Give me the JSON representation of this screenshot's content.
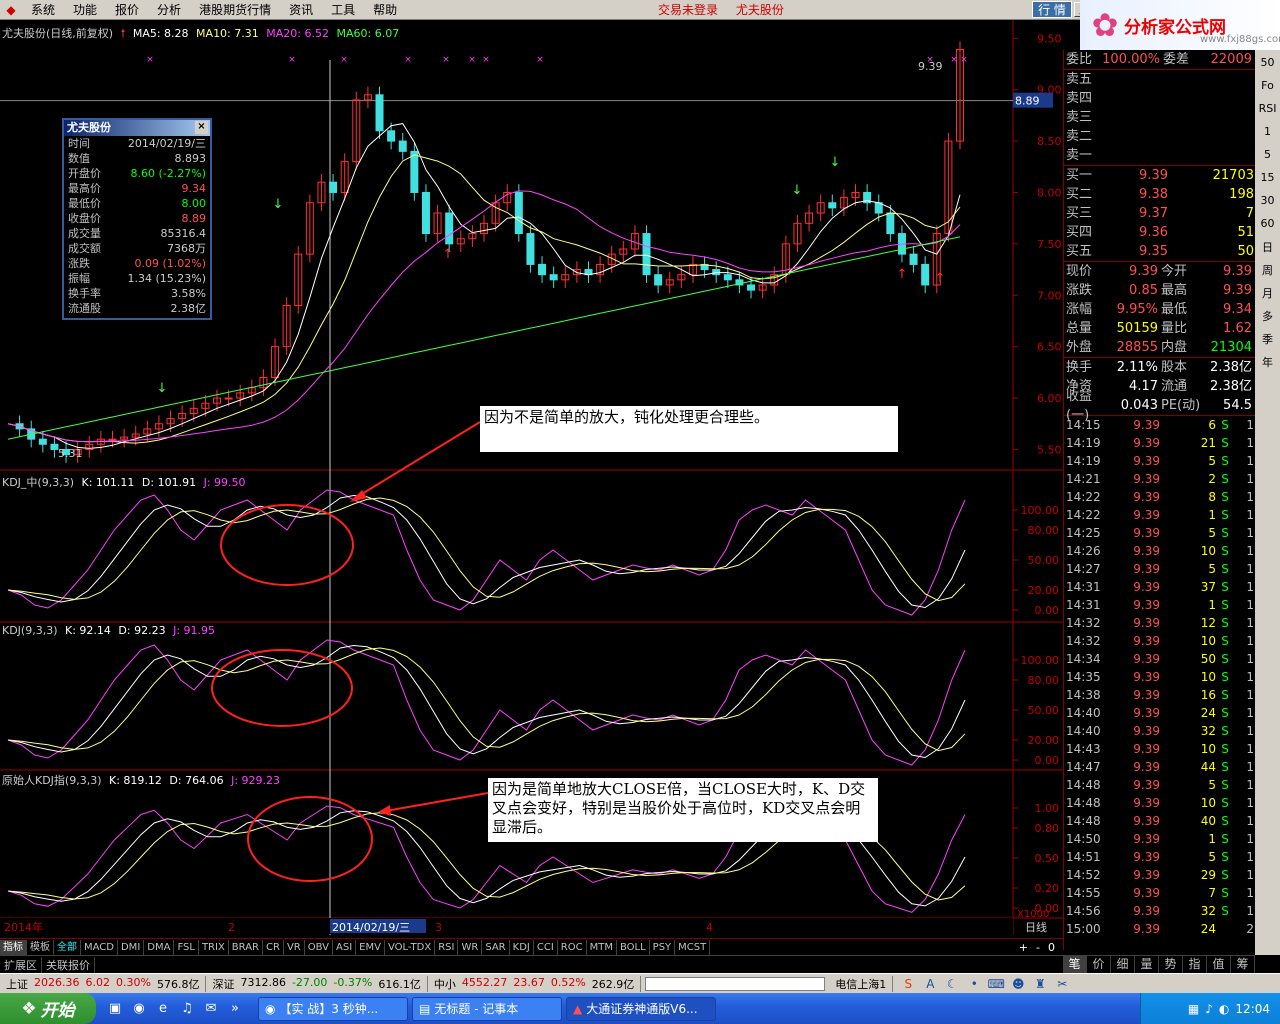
{
  "menubar": {
    "items": [
      "系统",
      "功能",
      "报价",
      "分析",
      "港股期货行情",
      "资讯",
      "工具",
      "帮助"
    ],
    "notice1": "交易未登录",
    "notice2": "尤夫股份",
    "trade": "行 情"
  },
  "banner": {
    "text": "分析家公式网",
    "url": "www.fxj88gs.com"
  },
  "main": {
    "title": "尤夫股份(日线,前复权)",
    "ma5": "MA5: 8.28",
    "ma10": "MA10: 7.31",
    "ma20": "MA20: 6.52",
    "ma60": "MA60: 6.07",
    "price_labels": [
      "9.50",
      "9.00",
      "8.50",
      "8.00",
      "7.50",
      "7.00",
      "6.50",
      "6.00",
      "5.50"
    ],
    "cursor_price": "8.89",
    "high_mark": "9.39",
    "low_mark": "5.31",
    "colors": {
      "ma5": "#ffffff",
      "ma10": "#ffff80",
      "ma20": "#ff40ff",
      "ma60": "#40ff40",
      "up": "#ff3030",
      "down": "#40e0e0"
    }
  },
  "infobox": {
    "title": "尤夫股份",
    "close": "×",
    "rows": [
      {
        "l": "时间",
        "v": "2014/02/19/三"
      },
      {
        "l": "数值",
        "v": "8.893"
      },
      {
        "l": "开盘价",
        "v": "8.60 (-2.27%)"
      },
      {
        "l": "最高价",
        "v": "9.34"
      },
      {
        "l": "最低价",
        "v": "8.00"
      },
      {
        "l": "收盘价",
        "v": "8.89"
      },
      {
        "l": "成交量",
        "v": "85316.4"
      },
      {
        "l": "成交额",
        "v": "7368万"
      },
      {
        "l": "涨跌",
        "v": "0.09 (1.02%)"
      },
      {
        "l": "振幅",
        "v": "1.34 (15.23%)"
      },
      {
        "l": "换手率",
        "v": "3.58%"
      },
      {
        "l": "流通股",
        "v": "2.38亿"
      }
    ]
  },
  "notes": {
    "n1": "因为不是简单的放大，钝化处理更合理些。",
    "n2": "因为是简单地放大CLOSE倍，当CLOSE大时，K、D交叉点会变好，特别是当股价处于高位时，KD交叉点会明显滞后。"
  },
  "kdj1": {
    "name": "KDJ_中(9,3,3)",
    "k": "K: 101.11",
    "d": "D: 101.91",
    "j": "J: 99.50",
    "ticks": [
      "100.00",
      "80.00",
      "50.00",
      "20.00",
      "0.00"
    ]
  },
  "kdj2": {
    "name": "KDJ(9,3,3)",
    "k": "K: 92.14",
    "d": "D: 92.23",
    "j": "J: 91.95",
    "ticks": [
      "100.00",
      "80.00",
      "50.00",
      "20.00",
      "0.00"
    ]
  },
  "kdj3": {
    "name": "原始人KDJ指(9,3,3)",
    "k": "K: 819.12",
    "d": "D: 764.06",
    "j": "J: 929.23",
    "ticks": [
      "1.00",
      "0.80",
      "0.50",
      "0.20",
      "0.00"
    ],
    "scale": "X1000"
  },
  "dateaxis": {
    "year": "2014年",
    "m2": "2",
    "cursor": "2014/02/19/三",
    "m3": "3",
    "m4": "4",
    "period": "日线"
  },
  "tabs": [
    "指标",
    "模板",
    "全部",
    "MACD",
    "DMI",
    "DMA",
    "FSL",
    "TRIX",
    "BRAR",
    "CR",
    "VR",
    "OBV",
    "ASI",
    "EMV",
    "VOL-TDX",
    "RSI",
    "WR",
    "SAR",
    "KDJ",
    "CCI",
    "ROC",
    "MTM",
    "BOLL",
    "PSY",
    "MCST"
  ],
  "tabnav": [
    "+",
    "-",
    "0"
  ],
  "extbar": [
    "扩展区",
    "关联报价"
  ],
  "orderbook": {
    "weibi_l": "委比",
    "weibi_v": "100.00%",
    "weicha_l": "委差",
    "weicha_v": "22009",
    "sells": [
      {
        "l": "卖五"
      },
      {
        "l": "卖四"
      },
      {
        "l": "卖三"
      },
      {
        "l": "卖二"
      },
      {
        "l": "卖一"
      }
    ],
    "buys": [
      {
        "l": "买一",
        "p": "9.39",
        "v": "21703"
      },
      {
        "l": "买二",
        "p": "9.38",
        "v": "198"
      },
      {
        "l": "买三",
        "p": "9.37",
        "v": "7"
      },
      {
        "l": "买四",
        "p": "9.36",
        "v": "51"
      },
      {
        "l": "买五",
        "p": "9.35",
        "v": "50"
      }
    ]
  },
  "quote": [
    {
      "l1": "现价",
      "v1": "9.39",
      "l2": "今开",
      "v2": "9.39",
      "c1": "#ff5050",
      "c2": "#ff5050"
    },
    {
      "l1": "涨跌",
      "v1": "0.85",
      "l2": "最高",
      "v2": "9.39",
      "c1": "#ff5050",
      "c2": "#ff5050"
    },
    {
      "l1": "涨幅",
      "v1": "9.95%",
      "l2": "最低",
      "v2": "9.34",
      "c1": "#ff5050",
      "c2": "#ff5050"
    },
    {
      "l1": "总量",
      "v1": "50159",
      "l2": "量比",
      "v2": "1.62",
      "c1": "#ffff00",
      "c2": "#ff5050"
    },
    {
      "l1": "外盘",
      "v1": "28855",
      "l2": "内盘",
      "v2": "21304",
      "c1": "#ff5050",
      "c2": "#00ff00"
    }
  ],
  "quote2": [
    {
      "l1": "换手",
      "v1": "2.11%",
      "l2": "股本",
      "v2": "2.38亿"
    },
    {
      "l1": "净资",
      "v1": "4.17",
      "l2": "流通",
      "v2": "2.38亿"
    },
    {
      "l1": "收益(一)",
      "v1": "0.043",
      "l2": "PE(动)",
      "v2": "54.5"
    }
  ],
  "ticks": [
    {
      "t": "14:15",
      "p": "9.39",
      "v": "6",
      "s": "S",
      "n": "1"
    },
    {
      "t": "14:19",
      "p": "9.39",
      "v": "21",
      "s": "S",
      "n": "1"
    },
    {
      "t": "14:19",
      "p": "9.39",
      "v": "5",
      "s": "S",
      "n": "1"
    },
    {
      "t": "14:21",
      "p": "9.39",
      "v": "2",
      "s": "S",
      "n": "1"
    },
    {
      "t": "14:22",
      "p": "9.39",
      "v": "8",
      "s": "S",
      "n": "1"
    },
    {
      "t": "14:22",
      "p": "9.39",
      "v": "1",
      "s": "S",
      "n": "1"
    },
    {
      "t": "14:25",
      "p": "9.39",
      "v": "5",
      "s": "S",
      "n": "1"
    },
    {
      "t": "14:26",
      "p": "9.39",
      "v": "10",
      "s": "S",
      "n": "1"
    },
    {
      "t": "14:27",
      "p": "9.39",
      "v": "5",
      "s": "S",
      "n": "1"
    },
    {
      "t": "14:31",
      "p": "9.39",
      "v": "37",
      "s": "S",
      "n": "1"
    },
    {
      "t": "14:31",
      "p": "9.39",
      "v": "1",
      "s": "S",
      "n": "1"
    },
    {
      "t": "14:32",
      "p": "9.39",
      "v": "12",
      "s": "S",
      "n": "1"
    },
    {
      "t": "14:32",
      "p": "9.39",
      "v": "10",
      "s": "S",
      "n": "1"
    },
    {
      "t": "14:34",
      "p": "9.39",
      "v": "50",
      "s": "S",
      "n": "1"
    },
    {
      "t": "14:35",
      "p": "9.39",
      "v": "10",
      "s": "S",
      "n": "1"
    },
    {
      "t": "14:38",
      "p": "9.39",
      "v": "16",
      "s": "S",
      "n": "1"
    },
    {
      "t": "14:40",
      "p": "9.39",
      "v": "24",
      "s": "S",
      "n": "1"
    },
    {
      "t": "14:40",
      "p": "9.39",
      "v": "32",
      "s": "S",
      "n": "1"
    },
    {
      "t": "14:43",
      "p": "9.39",
      "v": "10",
      "s": "S",
      "n": "1"
    },
    {
      "t": "14:47",
      "p": "9.39",
      "v": "44",
      "s": "S",
      "n": "1"
    },
    {
      "t": "14:48",
      "p": "9.39",
      "v": "5",
      "s": "S",
      "n": "1"
    },
    {
      "t": "14:48",
      "p": "9.39",
      "v": "10",
      "s": "S",
      "n": "1"
    },
    {
      "t": "14:48",
      "p": "9.39",
      "v": "40",
      "s": "S",
      "n": "1"
    },
    {
      "t": "14:50",
      "p": "9.39",
      "v": "1",
      "s": "S",
      "n": "1"
    },
    {
      "t": "14:51",
      "p": "9.39",
      "v": "5",
      "s": "S",
      "n": "1"
    },
    {
      "t": "14:52",
      "p": "9.39",
      "v": "29",
      "s": "S",
      "n": "1"
    },
    {
      "t": "14:55",
      "p": "9.39",
      "v": "7",
      "s": "S",
      "n": "1"
    },
    {
      "t": "14:56",
      "p": "9.39",
      "v": "32",
      "s": "S",
      "n": "1"
    },
    {
      "t": "15:00",
      "p": "9.39",
      "v": "24",
      "s": "",
      "n": "2"
    }
  ],
  "rtabs": [
    "笔",
    "价",
    "细",
    "量",
    "势",
    "指",
    "值",
    "筹"
  ],
  "sidebar": [
    "50",
    "Fo",
    "RSI",
    "1",
    "5",
    "15",
    "30",
    "60",
    "日",
    "周",
    "月",
    "多",
    "季",
    "年"
  ],
  "status": {
    "sh_l": "上证",
    "sh_v": "2026.36",
    "sh_c": "6.02",
    "sh_p": "0.30%",
    "sh_a": "576.8亿",
    "sz_l": "深证",
    "sz_v": "7312.86",
    "sz_c": "-27.00",
    "sz_p": "-0.37%",
    "sz_a": "616.1亿",
    "zx_l": "中小",
    "zx_v": "4552.27",
    "zx_c": "23.67",
    "zx_p": "0.52%",
    "zx_a": "262.9亿",
    "net": "电信上海1"
  },
  "taskbar": {
    "start": "开始",
    "tasks": [
      "【实  战】3 秒钟...",
      "无标题 - 记事本",
      "大通证券神通版V6..."
    ],
    "clock": "12:04"
  },
  "chart_data": {
    "type": "line",
    "panels": [
      {
        "name": "price",
        "ylim": [
          5.3,
          9.6
        ]
      },
      {
        "name": "KDJ_中(9,3,3)",
        "ylim": [
          -10,
          120
        ]
      },
      {
        "name": "KDJ(9,3,3)",
        "ylim": [
          -10,
          120
        ]
      },
      {
        "name": "原始人KDJ指(9,3,3)",
        "ylim": [
          -0.1,
          1.2
        ]
      }
    ]
  }
}
